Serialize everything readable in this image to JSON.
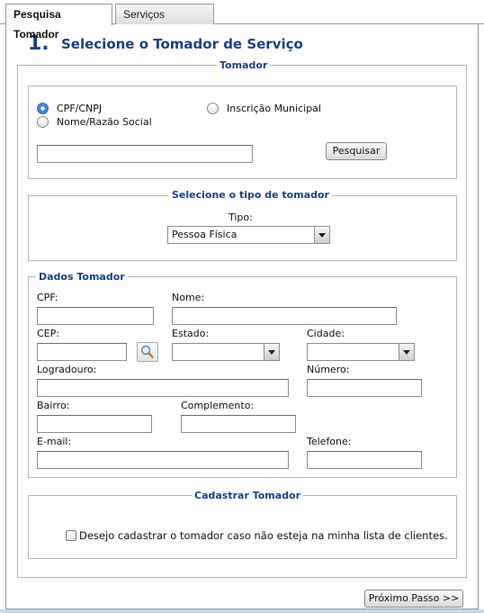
{
  "tabs": [
    {
      "label": "Pesquisa Tomador",
      "active": true
    },
    {
      "label": "Serviços Prestados",
      "active": false
    }
  ],
  "step": {
    "number": "1.",
    "title": "Selecione o Tomador de Serviço"
  },
  "tomador": {
    "legend": "Tomador",
    "options": [
      {
        "label": "CPF/CNPJ",
        "checked": true
      },
      {
        "label": "Inscrição Municipal",
        "checked": false
      },
      {
        "label": "Nome/Razão Social",
        "checked": false
      }
    ],
    "search_value": "",
    "search_button": "Pesquisar"
  },
  "tipo": {
    "legend": "Selecione o tipo de tomador",
    "label": "Tipo:",
    "selected": "Pessoa Física"
  },
  "dados": {
    "legend": "Dados Tomador",
    "cpf_label": "CPF:",
    "nome_label": "Nome:",
    "cep_label": "CEP:",
    "estado_label": "Estado:",
    "estado_value": "",
    "cidade_label": "Cidade:",
    "cidade_value": "",
    "logradouro_label": "Logradouro:",
    "numero_label": "Número:",
    "bairro_label": "Bairro:",
    "complemento_label": "Complemento:",
    "email_label": "E-mail:",
    "telefone_label": "Telefone:"
  },
  "cadastrar": {
    "legend": "Cadastrar Tomador",
    "checkbox_label": "Desejo cadastrar o tomador caso não esteja na minha lista de clientes.",
    "checked": false
  },
  "next_button": "Próximo Passo >>",
  "colors": {
    "accent": "#1b3f8a",
    "radio_selected": "#3b86e0"
  },
  "icons": {
    "cep_search": "magnifier-icon"
  }
}
